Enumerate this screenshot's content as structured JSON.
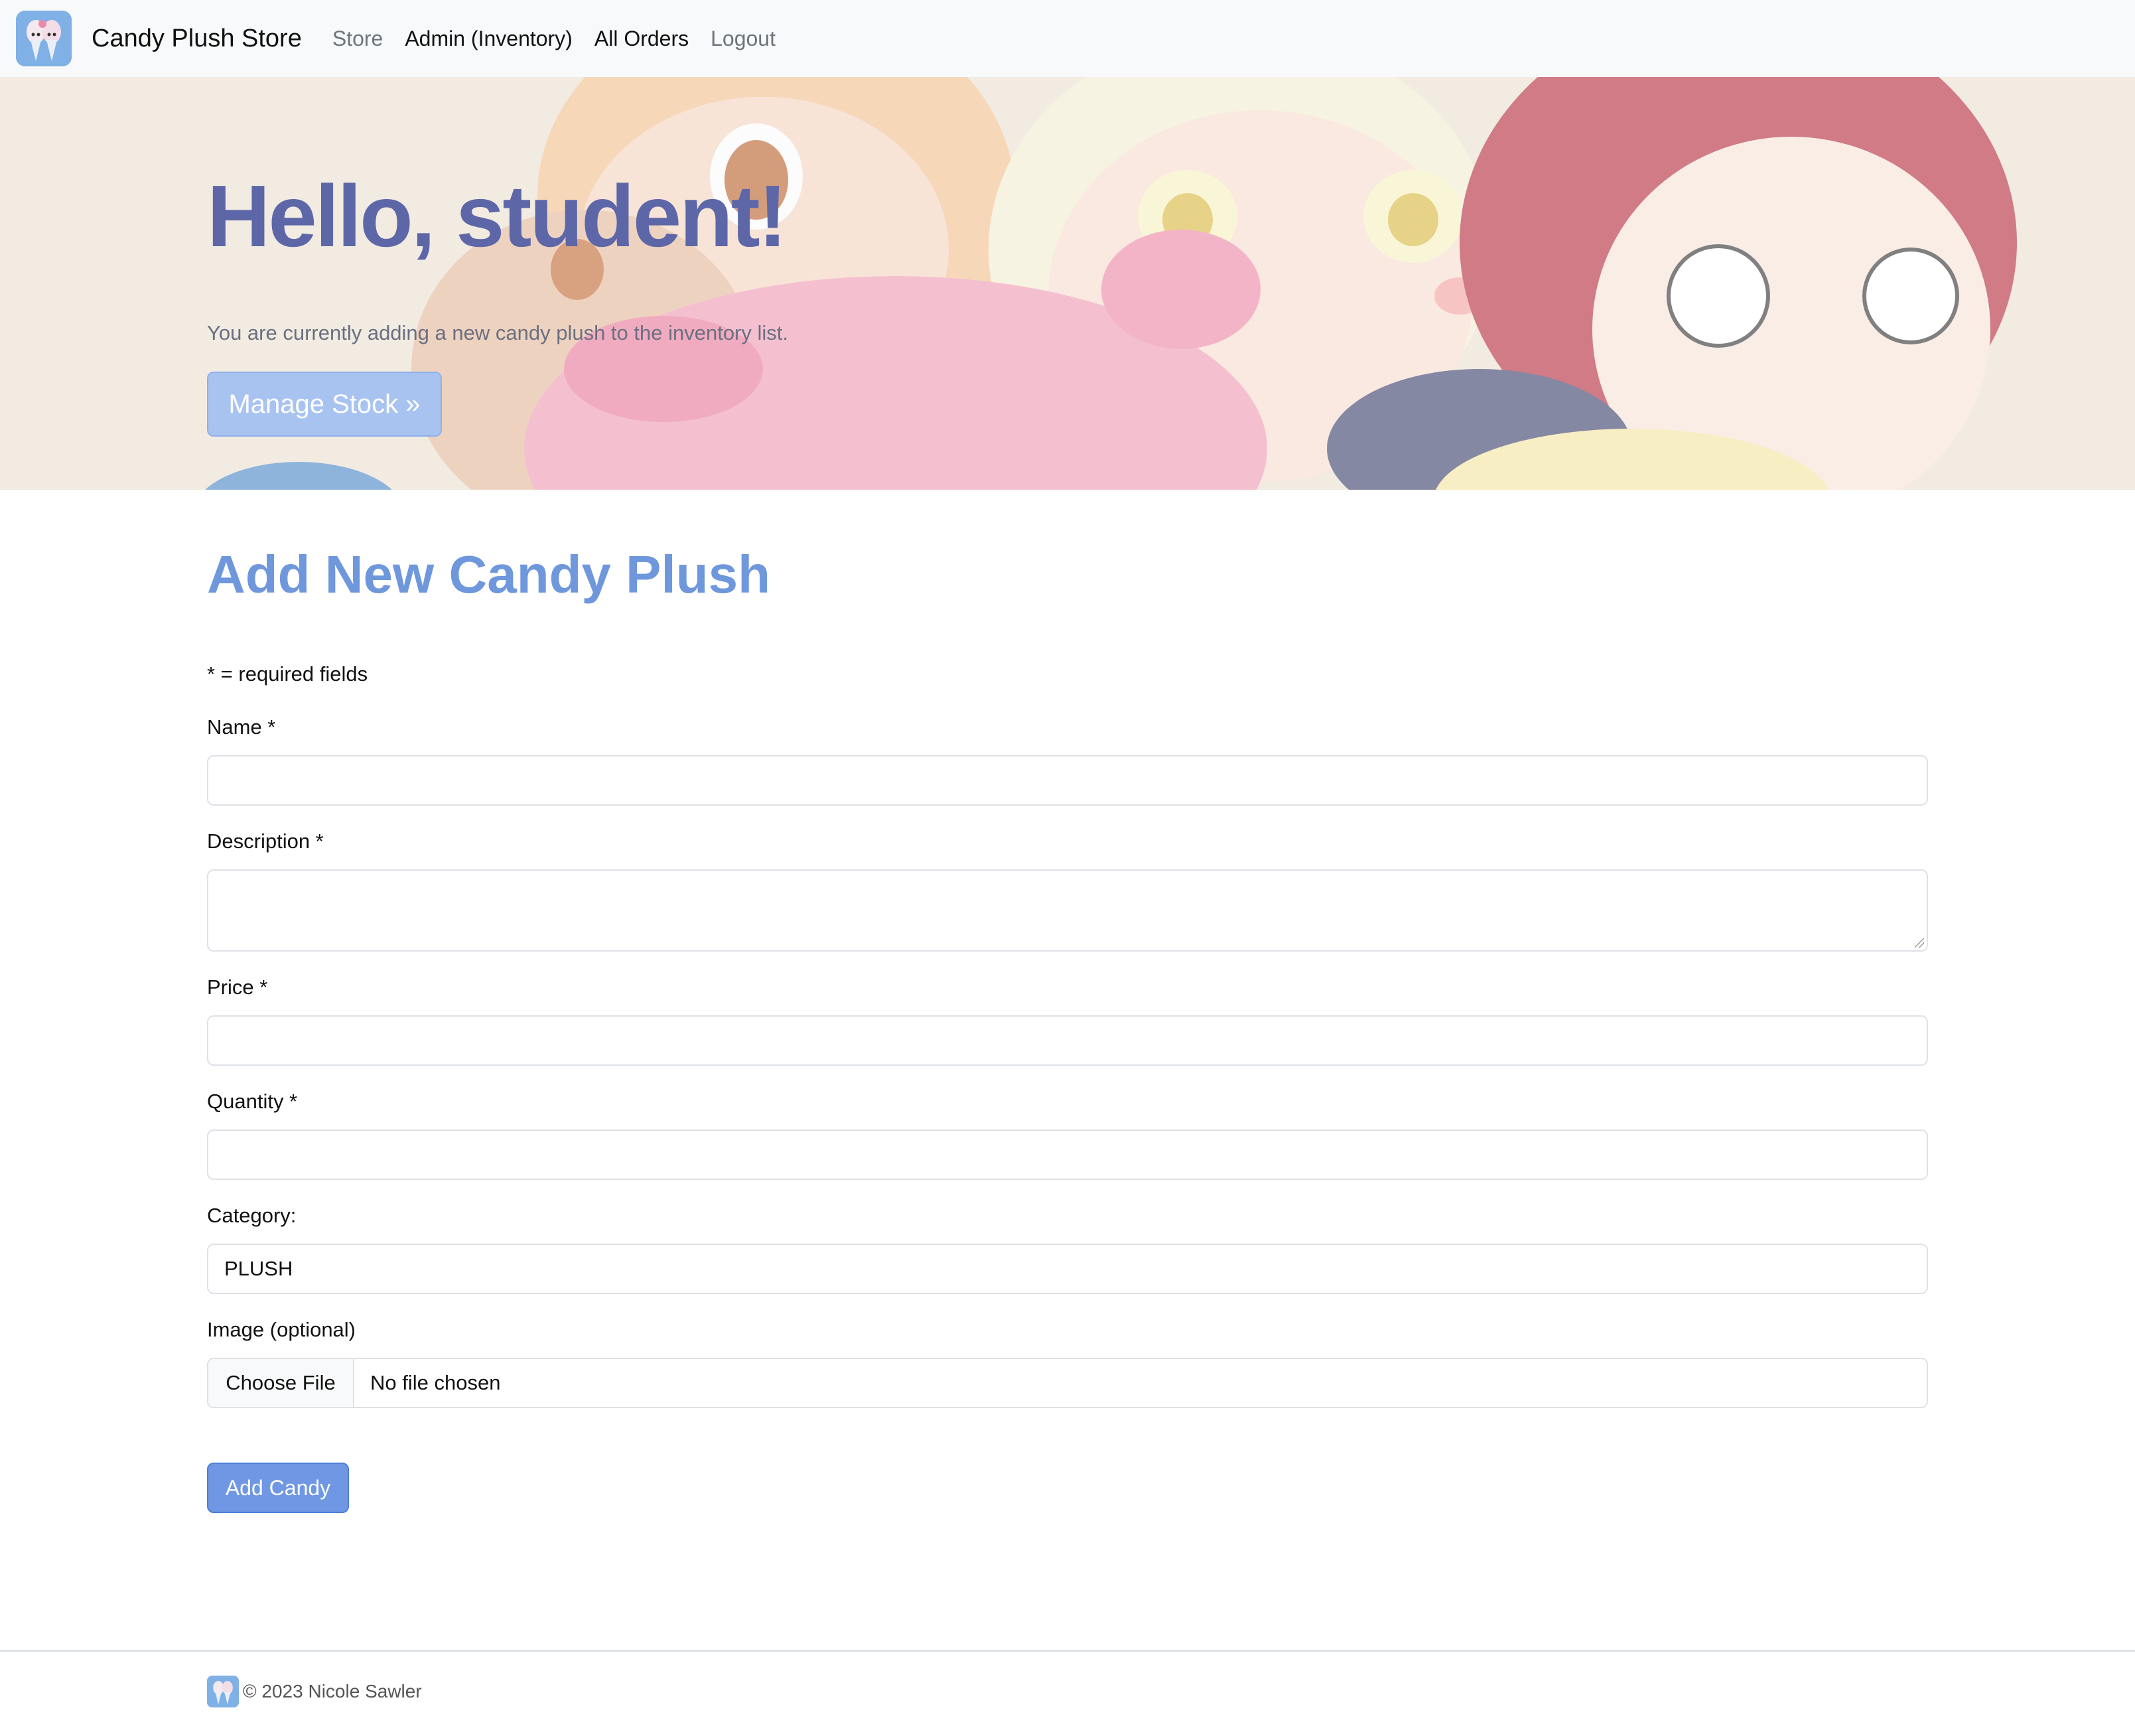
{
  "navbar": {
    "logo_icon": "cotton-candy-logo-icon",
    "brand": "Candy Plush Store",
    "links": [
      {
        "label": "Store",
        "style": "muted"
      },
      {
        "label": "Admin (Inventory)",
        "style": "dark"
      },
      {
        "label": "All Orders",
        "style": "dark"
      },
      {
        "label": "Logout",
        "style": "muted"
      }
    ]
  },
  "hero": {
    "title": "Hello, student!",
    "lead": "You are currently adding a new candy plush to the inventory list.",
    "button_label": "Manage Stock »"
  },
  "form": {
    "title": "Add New Candy Plush",
    "required_note": "* = required fields",
    "name_label": "Name *",
    "name_value": "",
    "description_label": "Description *",
    "description_value": "",
    "price_label": "Price *",
    "price_value": "",
    "quantity_label": "Quantity *",
    "quantity_value": "",
    "category_label": "Category:",
    "category_value": "PLUSH",
    "image_label": "Image (optional)",
    "file_button": "Choose File",
    "file_status": "No file chosen",
    "submit_label": "Add Candy"
  },
  "footer": {
    "logo_icon": "cotton-candy-logo-icon",
    "text": "© 2023 Nicole Sawler"
  },
  "colors": {
    "accent": "#6f97e3",
    "hero_title": "#5d67a8",
    "section_title": "#6f97dc",
    "navbar_bg": "#f8f9fa"
  }
}
